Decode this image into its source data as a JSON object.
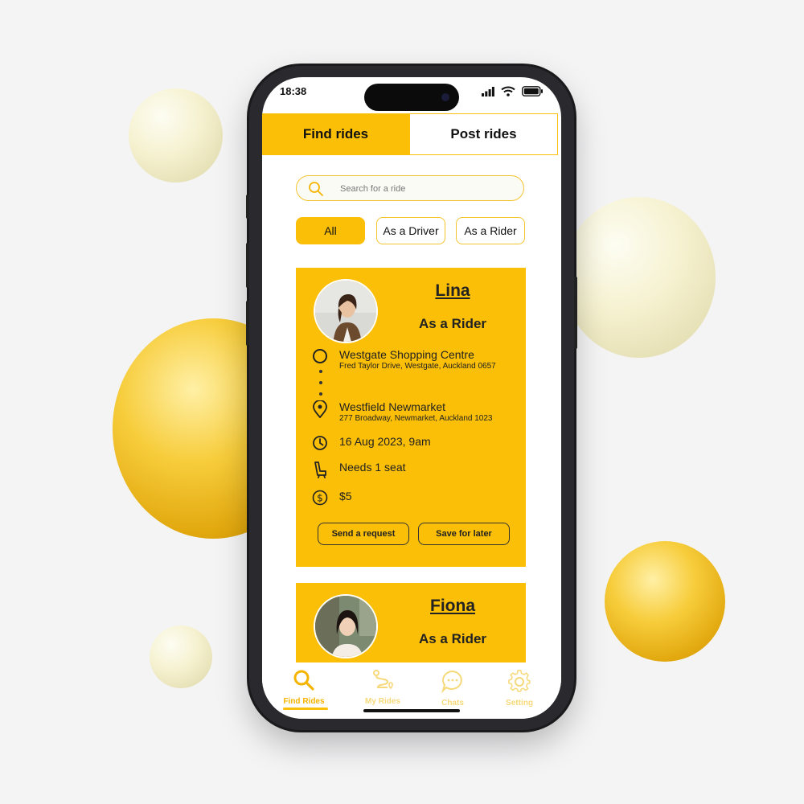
{
  "status": {
    "time": "18:38"
  },
  "tabs": {
    "find": "Find rides",
    "post": "Post rides"
  },
  "search": {
    "placeholder": "Search for a ride"
  },
  "filters": {
    "all": "All",
    "driver": "As a Driver",
    "rider": "As a Rider",
    "selected": "All"
  },
  "rides": [
    {
      "name": "Lina",
      "role": "As a Rider",
      "from_title": "Westgate Shopping Centre",
      "from_address": "Fred Taylor Drive, Westgate, Auckland 0657",
      "to_title": "Westfield Newmarket",
      "to_address": "277 Broadway, Newmarket, Auckland 1023",
      "datetime": "16 Aug 2023, 9am",
      "seats": "Needs 1 seat",
      "price": "$5",
      "request_label": "Send a request",
      "save_label": "Save for later"
    },
    {
      "name": "Fiona",
      "role": "As a Rider"
    }
  ],
  "nav": {
    "find": "Find Rides",
    "my": "My Rides",
    "chats": "Chats",
    "setting": "Setting",
    "active": "Find Rides"
  },
  "colors": {
    "accent": "#fbbf08",
    "text": "#222222",
    "nav_inactive": "#f6d97a"
  },
  "icons": [
    "search-icon",
    "location-circle-icon",
    "map-pin-icon",
    "clock-icon",
    "car-seat-icon",
    "dollar-icon",
    "route-icon",
    "chat-icon",
    "gear-icon"
  ]
}
